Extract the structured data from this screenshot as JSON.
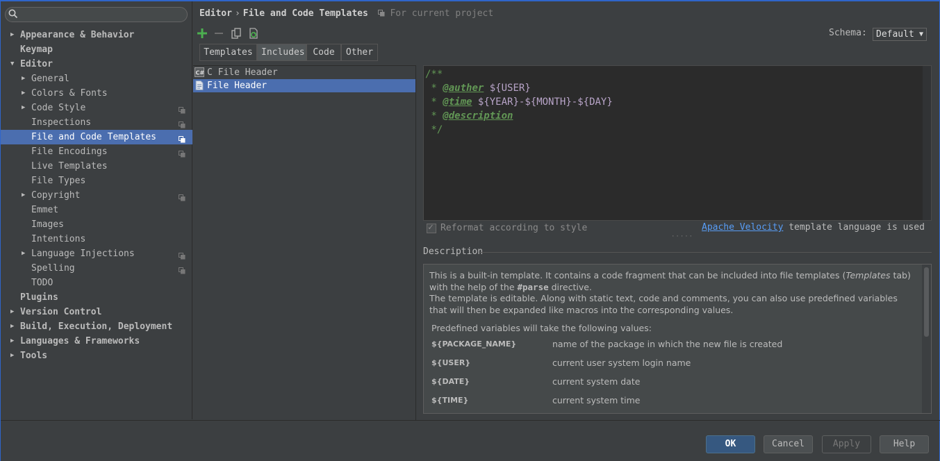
{
  "search": {
    "placeholder": "",
    "value": ""
  },
  "sidebar": {
    "items": [
      {
        "label": "Appearance & Behavior",
        "level": 0,
        "arrow": "right",
        "bold": true,
        "project": false
      },
      {
        "label": "Keymap",
        "level": 0,
        "arrow": "",
        "bold": true,
        "project": false
      },
      {
        "label": "Editor",
        "level": 0,
        "arrow": "down",
        "bold": true,
        "project": false
      },
      {
        "label": "General",
        "level": 1,
        "arrow": "right",
        "bold": false,
        "project": false
      },
      {
        "label": "Colors & Fonts",
        "level": 1,
        "arrow": "right",
        "bold": false,
        "project": false
      },
      {
        "label": "Code Style",
        "level": 1,
        "arrow": "right",
        "bold": false,
        "project": true
      },
      {
        "label": "Inspections",
        "level": 1,
        "arrow": "",
        "bold": false,
        "project": true
      },
      {
        "label": "File and Code Templates",
        "level": 1,
        "arrow": "",
        "bold": false,
        "project": true,
        "selected": true
      },
      {
        "label": "File Encodings",
        "level": 1,
        "arrow": "",
        "bold": false,
        "project": true
      },
      {
        "label": "Live Templates",
        "level": 1,
        "arrow": "",
        "bold": false,
        "project": false
      },
      {
        "label": "File Types",
        "level": 1,
        "arrow": "",
        "bold": false,
        "project": false
      },
      {
        "label": "Copyright",
        "level": 1,
        "arrow": "right",
        "bold": false,
        "project": true
      },
      {
        "label": "Emmet",
        "level": 1,
        "arrow": "",
        "bold": false,
        "project": false
      },
      {
        "label": "Images",
        "level": 1,
        "arrow": "",
        "bold": false,
        "project": false
      },
      {
        "label": "Intentions",
        "level": 1,
        "arrow": "",
        "bold": false,
        "project": false
      },
      {
        "label": "Language Injections",
        "level": 1,
        "arrow": "right",
        "bold": false,
        "project": true
      },
      {
        "label": "Spelling",
        "level": 1,
        "arrow": "",
        "bold": false,
        "project": true
      },
      {
        "label": "TODO",
        "level": 1,
        "arrow": "",
        "bold": false,
        "project": false
      },
      {
        "label": "Plugins",
        "level": 0,
        "arrow": "",
        "bold": true,
        "project": false
      },
      {
        "label": "Version Control",
        "level": 0,
        "arrow": "right",
        "bold": true,
        "project": false
      },
      {
        "label": "Build, Execution, Deployment",
        "level": 0,
        "arrow": "right",
        "bold": true,
        "project": false
      },
      {
        "label": "Languages & Frameworks",
        "level": 0,
        "arrow": "right",
        "bold": true,
        "project": false
      },
      {
        "label": "Tools",
        "level": 0,
        "arrow": "right",
        "bold": true,
        "project": false
      }
    ]
  },
  "header": {
    "crumb1": "Editor",
    "sep": "›",
    "crumb2": "File and Code Templates",
    "scope": "For current project"
  },
  "schema": {
    "label": "Schema:",
    "value": "Default"
  },
  "tabs": [
    {
      "label": "Templates",
      "active": false
    },
    {
      "label": "Includes",
      "active": true
    },
    {
      "label": "Code",
      "active": false
    },
    {
      "label": "Other",
      "active": false
    }
  ],
  "files": [
    {
      "label": "C File Header",
      "icon": "c-file-icon",
      "selected": false
    },
    {
      "label": "File Header",
      "icon": "file-template-icon",
      "selected": true
    }
  ],
  "editor": {
    "line1": "/**",
    "line2_prefix": " * ",
    "tag_auther": "@auther",
    "var_user": "${USER}",
    "tag_time": "@time",
    "var_year": "${YEAR}",
    "dash": "-",
    "var_month": "${MONTH}",
    "var_day": "${DAY}",
    "tag_description": "@description",
    "line_end": " */"
  },
  "reformat": {
    "label": "Reformat according to style",
    "checked": true
  },
  "velocity": {
    "link": "Apache Velocity",
    "suffix": " template language is used"
  },
  "description": {
    "title": "Description",
    "p1_a": "This is a built-in template. It contains a code fragment that can be included into file templates (",
    "p1_em": "Templates",
    "p1_b": " tab) with the help of the ",
    "p1_strong": "#parse",
    "p1_c": " directive.",
    "p2": "The template is editable. Along with static text, code and comments, you can also use predefined variables that will then be expanded like macros into the corresponding values.",
    "vars_intro": "Predefined variables will take the following values:",
    "vars": [
      {
        "name": "${PACKAGE_NAME}",
        "desc": "name of the package in which the new file is created"
      },
      {
        "name": "${USER}",
        "desc": "current user system login name"
      },
      {
        "name": "${DATE}",
        "desc": "current system date"
      },
      {
        "name": "${TIME}",
        "desc": "current system time"
      }
    ]
  },
  "buttons": {
    "ok": "OK",
    "cancel": "Cancel",
    "apply": "Apply",
    "help": "Help"
  },
  "colors": {
    "background": "#3c3f41",
    "selection": "#4b6eaf",
    "editor_bg": "#2b2b2b",
    "comment_green": "#629755",
    "variable_purple": "#b8a4c8",
    "link_blue": "#589df6",
    "add_green": "#4caf50"
  }
}
